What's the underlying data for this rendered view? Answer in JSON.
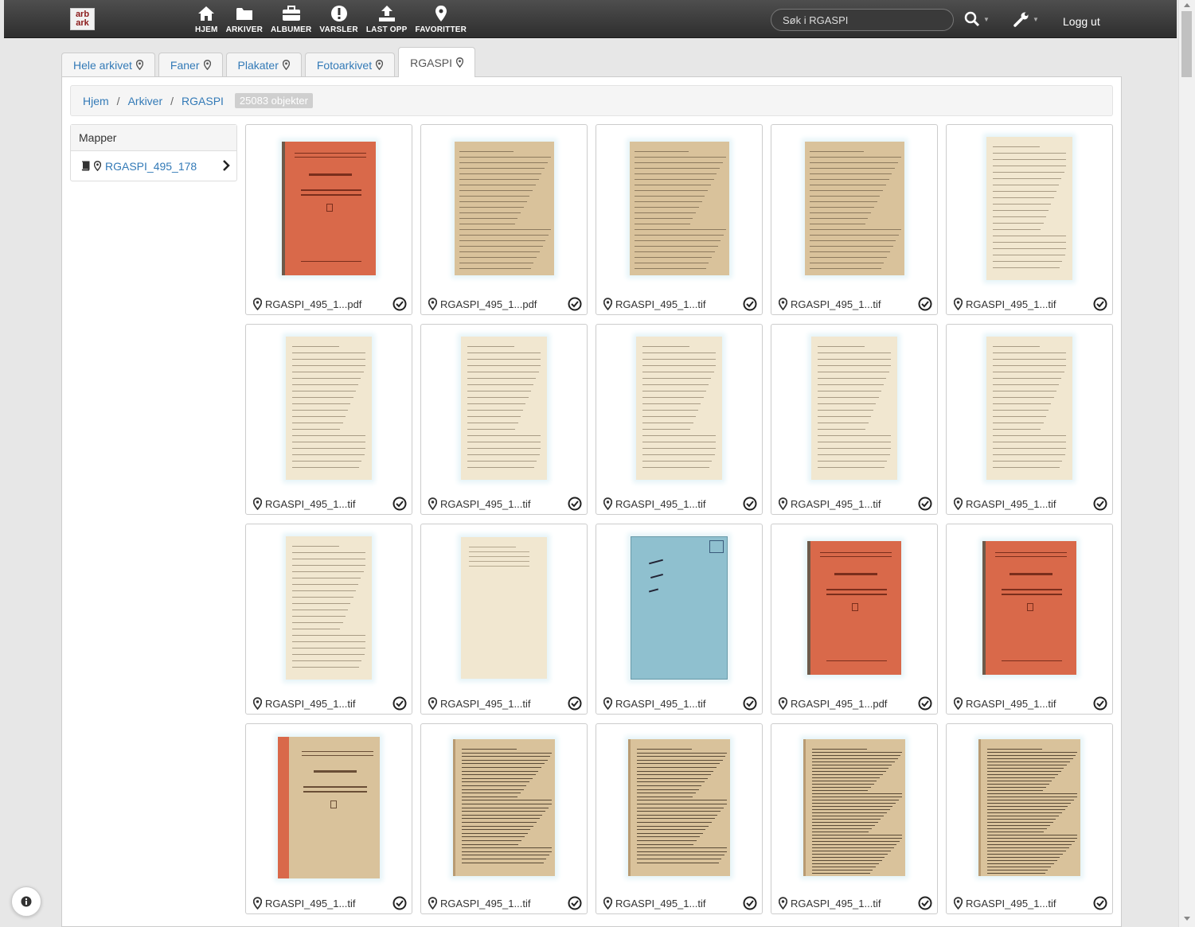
{
  "header": {
    "logo_top": "arb",
    "logo_bottom": "ark",
    "nav": [
      {
        "label": "HJEM",
        "icon": "home-icon"
      },
      {
        "label": "ARKIVER",
        "icon": "folder-icon"
      },
      {
        "label": "ALBUMER",
        "icon": "briefcase-icon"
      },
      {
        "label": "VARSLER",
        "icon": "alert-icon"
      },
      {
        "label": "LAST OPP",
        "icon": "upload-icon"
      },
      {
        "label": "FAVORITTER",
        "icon": "map-marker-icon"
      }
    ],
    "search_placeholder": "Søk i RGASPI",
    "logout": "Logg ut"
  },
  "tabs": [
    {
      "label": "Hele arkivet",
      "active": false
    },
    {
      "label": "Faner",
      "active": false
    },
    {
      "label": "Plakater",
      "active": false
    },
    {
      "label": "Fotoarkivet",
      "active": false
    },
    {
      "label": "RGASPI",
      "active": true
    }
  ],
  "breadcrumb": {
    "items": [
      "Hjem",
      "Arkiver",
      "RGASPI"
    ],
    "count": "25083 objekter"
  },
  "sidebar": {
    "title": "Mapper",
    "items": [
      {
        "label": "RGASPI_495_178"
      }
    ]
  },
  "items": [
    {
      "name": "RGASPI_495_1...pdf",
      "kind": "cover-red"
    },
    {
      "name": "RGASPI_495_1...pdf",
      "kind": "typed-tan"
    },
    {
      "name": "RGASPI_495_1...tif",
      "kind": "typed-tan"
    },
    {
      "name": "RGASPI_495_1...tif",
      "kind": "typed-tan"
    },
    {
      "name": "RGASPI_495_1...tif",
      "kind": "typed-cream"
    },
    {
      "name": "RGASPI_495_1...tif",
      "kind": "typed-cream"
    },
    {
      "name": "RGASPI_495_1...tif",
      "kind": "typed-cream"
    },
    {
      "name": "RGASPI_495_1...tif",
      "kind": "typed-cream"
    },
    {
      "name": "RGASPI_495_1...tif",
      "kind": "typed-cream"
    },
    {
      "name": "RGASPI_495_1...tif",
      "kind": "typed-cream"
    },
    {
      "name": "RGASPI_495_1...tif",
      "kind": "typed-cream"
    },
    {
      "name": "RGASPI_495_1...tif",
      "kind": "blank-cream"
    },
    {
      "name": "RGASPI_495_1...tif",
      "kind": "folder-blue"
    },
    {
      "name": "RGASPI_495_1...pdf",
      "kind": "cover-red"
    },
    {
      "name": "RGASPI_495_1...tif",
      "kind": "cover-red"
    },
    {
      "name": "RGASPI_495_1...tif",
      "kind": "cover-red-spine"
    },
    {
      "name": "RGASPI_495_1...tif",
      "kind": "print-tan"
    },
    {
      "name": "RGASPI_495_1...tif",
      "kind": "print-tan"
    },
    {
      "name": "RGASPI_495_1...tif",
      "kind": "print-tan-dense"
    },
    {
      "name": "RGASPI_495_1...tif",
      "kind": "print-tan-dense"
    }
  ],
  "colors": {
    "link": "#337ab7",
    "cover_red": "#d9694a",
    "paper_tan": "#d9c29b",
    "paper_cream": "#f1e7d0",
    "folder_blue": "#8fc0cf"
  }
}
